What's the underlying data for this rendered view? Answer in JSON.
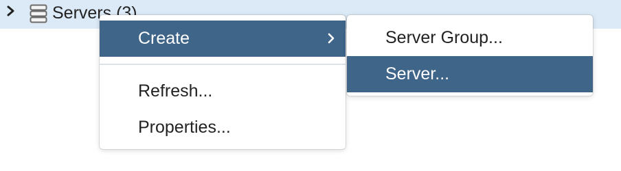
{
  "tree": {
    "node_label": "Servers (3)",
    "expander_icon": "chevron-right-icon",
    "node_icon": "server-group-icon",
    "selected_bg": "#dce9f6"
  },
  "context_menu": {
    "items": [
      {
        "label": "Create",
        "has_submenu": true,
        "active": true
      },
      {
        "label": "Refresh...",
        "has_submenu": false,
        "active": false
      },
      {
        "label": "Properties...",
        "has_submenu": false,
        "active": false
      }
    ],
    "active_bg": "#3f6589"
  },
  "submenu": {
    "items": [
      {
        "label": "Server Group...",
        "active": false
      },
      {
        "label": "Server...",
        "active": true
      }
    ]
  }
}
